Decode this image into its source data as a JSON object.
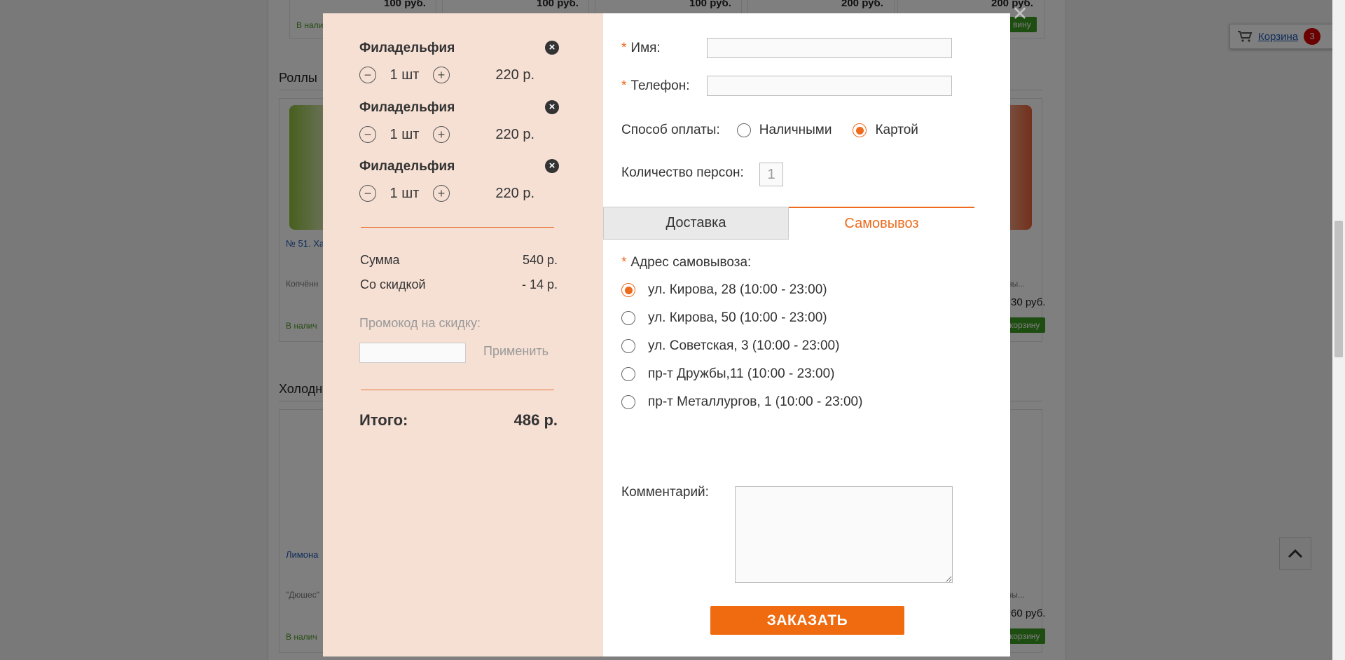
{
  "background": {
    "prices_top": [
      "100 руб.",
      "100 руб.",
      "100 руб.",
      "200 руб.",
      "200 руб."
    ],
    "stock_text": "В нали",
    "section_rolls": "Роллы",
    "section_cold": "Холодн",
    "item_link_1": "№ 51. Ха",
    "item_desc_1": "Копчённ",
    "item_desc_right_1": "елёны...",
    "item_price_right_1": "30 руб.",
    "item_link_2": "Лимона",
    "item_desc_2": "\"Дюшес\"",
    "item_desc_right_2": "лесны...",
    "item_price_right_2": "60 руб.",
    "stock_text_2": "В налич",
    "add_btn_partial_top": "вину",
    "add_btn_partial": "корзину"
  },
  "cart_widget": {
    "label": "Корзина",
    "count": "3"
  },
  "cart": {
    "items": [
      {
        "name": "Филадельфия",
        "qty": "1 шт",
        "price": "220 р."
      },
      {
        "name": "Филадельфия",
        "qty": "1 шт",
        "price": "220 р."
      },
      {
        "name": "Филадельфия",
        "qty": "1 шт",
        "price": "220 р."
      }
    ],
    "sum_label": "Сумма",
    "sum_value": "540 р.",
    "discount_label": "Со скидкой",
    "discount_value": "- 14 р.",
    "promo_label": "Промокод на скидку:",
    "promo_apply": "Применить",
    "total_label": "Итого:",
    "total_value": "486 р."
  },
  "form": {
    "name_label": "Имя:",
    "phone_label": "Телефон:",
    "payment_label": "Способ оплаты:",
    "payment_options": [
      {
        "label": "Наличными",
        "checked": false
      },
      {
        "label": "Картой",
        "checked": true
      }
    ],
    "persons_label": "Количество персон:",
    "persons_placeholder": "1",
    "tabs": [
      {
        "label": "Доставка",
        "active": false
      },
      {
        "label": "Самовывоз",
        "active": true
      }
    ],
    "pickup_label": "Адрес самовывоза:",
    "pickup_addresses": [
      {
        "label": "ул. Кирова, 28 (10:00 - 23:00)",
        "checked": true
      },
      {
        "label": "ул. Кирова, 50 (10:00 - 23:00)",
        "checked": false
      },
      {
        "label": "ул. Советская, 3 (10:00 - 23:00)",
        "checked": false
      },
      {
        "label": "пр-т Дружбы,11 (10:00 - 23:00)",
        "checked": false
      },
      {
        "label": "пр-т Металлургов, 1 (10:00 - 23:00)",
        "checked": false
      }
    ],
    "comment_label": "Комментарий:",
    "submit_label": "ЗАКАЗАТЬ"
  },
  "colors": {
    "accent": "#ee6a1c",
    "left_panel": "#f6e0d4",
    "button": "#f06a0f"
  }
}
